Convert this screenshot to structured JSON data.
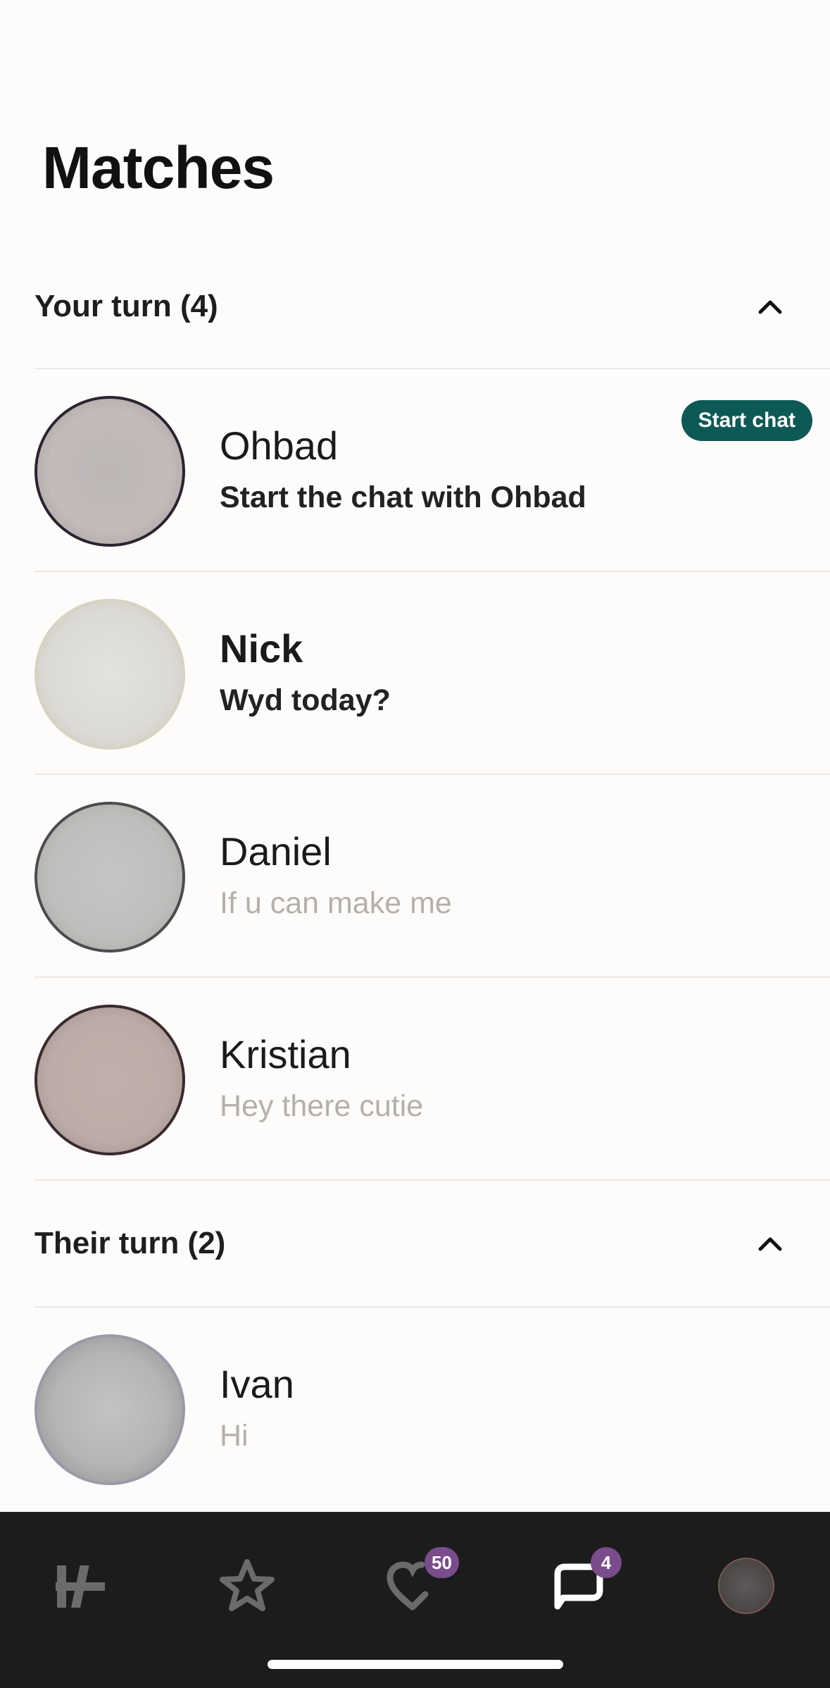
{
  "header": {
    "title": "Matches"
  },
  "sections": [
    {
      "title": "Your turn (4)",
      "matches": [
        {
          "name": "Ohbad",
          "preview": "Start the chat with Ohbad",
          "action": "Start chat"
        },
        {
          "name": "Nick",
          "preview": "Wyd today?"
        },
        {
          "name": "Daniel",
          "preview": "If u can make me"
        },
        {
          "name": "Kristian",
          "preview": "Hey there cutie"
        }
      ]
    },
    {
      "title": "Their turn (2)",
      "matches": [
        {
          "name": "Ivan",
          "preview": "Hi"
        }
      ]
    }
  ],
  "tabbar": {
    "items": [
      {
        "icon": "hinge-logo-icon"
      },
      {
        "icon": "star-icon"
      },
      {
        "icon": "likes-heart-icon",
        "badge": "50"
      },
      {
        "icon": "chat-bubble-icon",
        "badge": "4"
      },
      {
        "icon": "profile-avatar"
      }
    ]
  },
  "colors": {
    "accent": "#0d5955",
    "badge": "#7a4c8c",
    "tabbar_bg": "#1c1c1c",
    "muted_text": "#b3b0ad"
  }
}
